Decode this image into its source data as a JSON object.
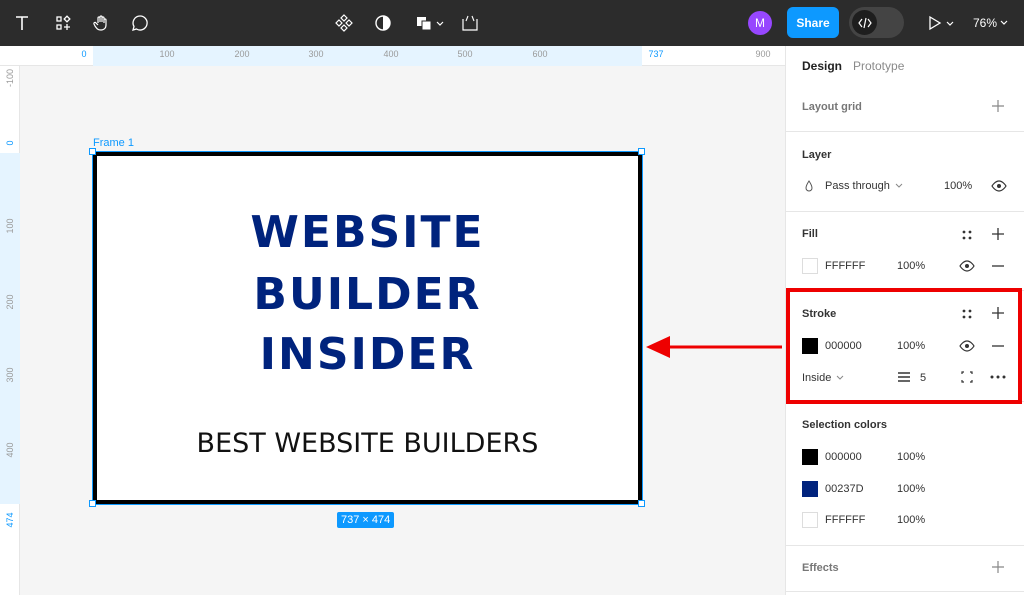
{
  "toolbar": {
    "share_label": "Share",
    "avatar_initial": "M",
    "zoom": "76%"
  },
  "ruler": {
    "top": [
      "0",
      "100",
      "200",
      "300",
      "400",
      "500",
      "600",
      "737",
      "900"
    ],
    "left": [
      "-100",
      "0",
      "100",
      "200",
      "300",
      "400",
      "474"
    ]
  },
  "canvas": {
    "frame_name": "Frame 1",
    "headline": [
      "WEBSITE",
      "BUILDER",
      "INSIDER"
    ],
    "subheadline": "BEST WEBSITE BUILDERS",
    "size_badge": "737 × 474",
    "headline_color": "#00237D"
  },
  "panel": {
    "tabs": [
      "Design",
      "Prototype"
    ],
    "layout_grid": "Layout grid",
    "layer": {
      "title": "Layer",
      "blend": "Pass through",
      "opacity": "100%"
    },
    "fill": {
      "title": "Fill",
      "hex": "FFFFFF",
      "opacity": "100%"
    },
    "stroke": {
      "title": "Stroke",
      "hex": "000000",
      "opacity": "100%",
      "position": "Inside",
      "weight": "5"
    },
    "selection_colors": {
      "title": "Selection colors",
      "items": [
        {
          "hex": "000000",
          "opacity": "100%",
          "color": "#000000"
        },
        {
          "hex": "00237D",
          "opacity": "100%",
          "color": "#00237D"
        },
        {
          "hex": "FFFFFF",
          "opacity": "100%",
          "color": "#FFFFFF"
        }
      ]
    },
    "effects": "Effects"
  },
  "colors": {
    "accent": "#0D99FF",
    "annotation": "#E00000"
  }
}
